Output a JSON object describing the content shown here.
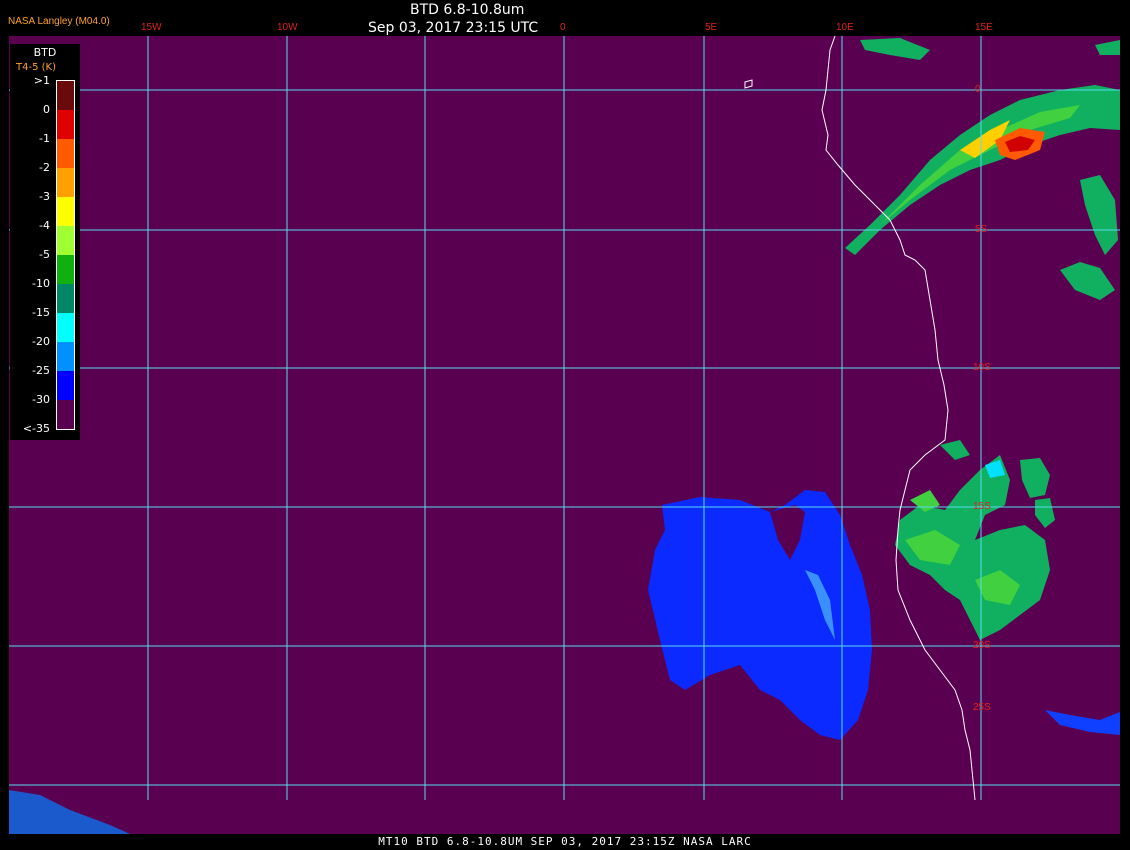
{
  "header": {
    "title": "BTD 6.8-10.8um",
    "timestamp": "Sep 03, 2017 23:15 UTC",
    "credit": "NASA Langley (M04.0)"
  },
  "footer": {
    "text": "MT10   BTD 6.8-10.8UM   SEP 03, 2017 23:15Z   NASA LARC"
  },
  "legend": {
    "title": "BTD",
    "units": "T4-5 (K)",
    "labels": [
      ">1",
      "0",
      "-1",
      "-2",
      "-3",
      "-4",
      "-5",
      "-10",
      "-15",
      "-20",
      "-25",
      "-30",
      "<-35"
    ],
    "colors": [
      "#6a0a0a",
      "#e00000",
      "#ff5a00",
      "#ffa000",
      "#ffff00",
      "#a0ff30",
      "#10b010",
      "#008866",
      "#00ffff",
      "#0090ff",
      "#0000ff",
      "#5a0050"
    ]
  },
  "grid": {
    "lon_labels": [
      "15W",
      "10W",
      "0",
      "5E",
      "10E",
      "15E"
    ],
    "lat_labels": [
      "0",
      "5S",
      "10S",
      "15S",
      "20S",
      "25S"
    ]
  },
  "colors": {
    "background": "#5a0050",
    "gridlines": "#55ddee",
    "coastline": "#ffffff",
    "label_red": "#e02020",
    "label_orange": "#ffa030"
  }
}
